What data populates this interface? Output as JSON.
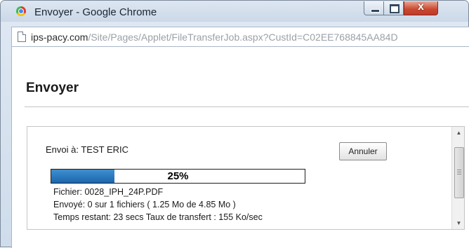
{
  "window": {
    "title": "Envoyer - Google Chrome",
    "controls": {
      "minimize": "–",
      "maximize": "□",
      "close": "x"
    }
  },
  "address_bar": {
    "domain": "ips-pacy.com",
    "path": "/Site/Pages/Applet/FileTransferJob.aspx?CustId=C02EE768845AA84D"
  },
  "page": {
    "title": "Envoyer"
  },
  "transfer": {
    "recipient": "Envoi à: TEST ERIC",
    "cancel_label": "Annuler",
    "progress_percent": 25,
    "progress_label": "25%",
    "file_line": "Fichier: 0028_IPH_24P.PDF",
    "sent_line": "Envoyé: 0 sur 1 fichiers ( 1.25 Mo de 4.85 Mo )",
    "time_line": "Temps restant: 23 secs Taux de transfert : 155 Ko/sec"
  },
  "scrollbar": {
    "up_arrow": "▲",
    "down_arrow": "▼"
  },
  "colors": {
    "progress_fill": "#2a76be",
    "close_button": "#c9482d",
    "url_domain": "#2d2d2d",
    "url_path": "#9aa1a8"
  }
}
